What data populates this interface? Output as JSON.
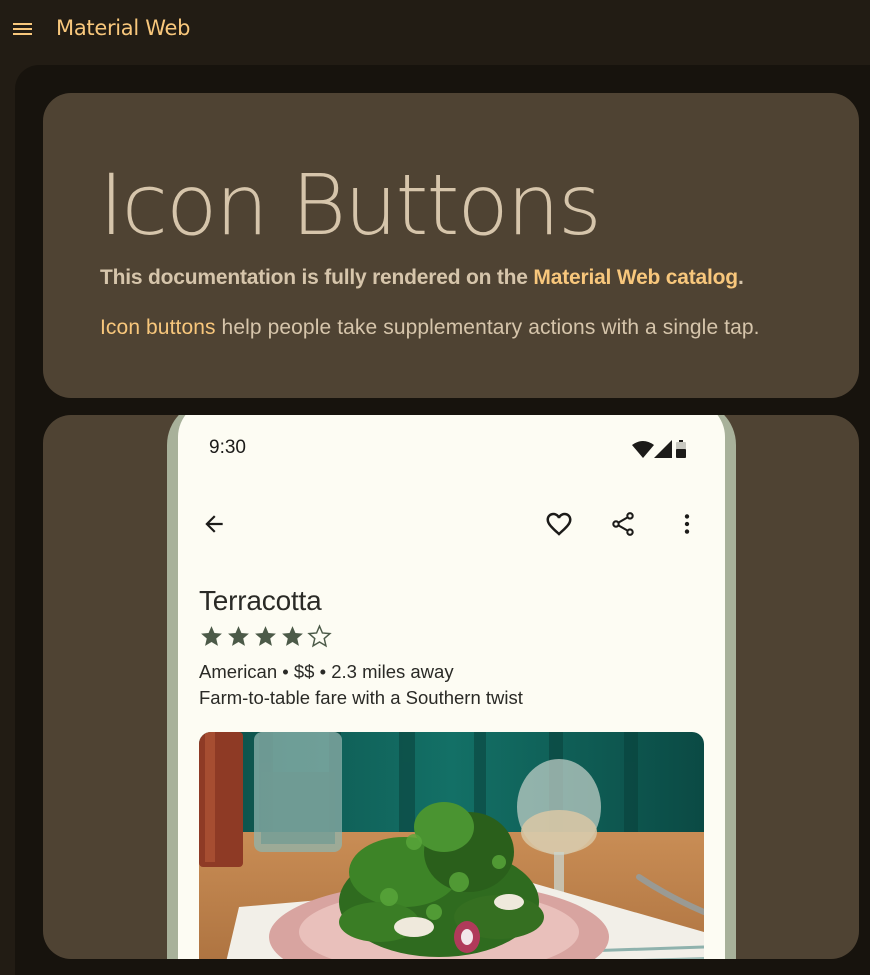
{
  "app": {
    "title": "Material Web"
  },
  "hero": {
    "title": "Icon Buttons",
    "subtitle_prefix": "This documentation is fully rendered on the ",
    "subtitle_link": "Material Web catalog",
    "subtitle_suffix": ".",
    "desc_link": "Icon buttons",
    "desc_rest": " help people take supplementary actions with a single tap."
  },
  "phone": {
    "status_time": "9:30",
    "status_icons": [
      "wifi-icon",
      "signal-icon",
      "battery-icon"
    ],
    "toolbar_icons": [
      "arrow-back-icon",
      "heart-outline-icon",
      "share-icon",
      "more-vert-icon"
    ],
    "restaurant": {
      "name": "Terracotta",
      "rating": 4,
      "rating_max": 5,
      "meta": "American • $$ • 2.3 miles away",
      "description": "Farm-to-table fare with a Southern twist"
    }
  },
  "colors": {
    "background": "#221c14",
    "panel": "#17130d",
    "card": "#4f4333",
    "accent": "#f8c77c",
    "text": "#d6c5ab",
    "phone_frame": "#a8b19a",
    "phone_screen": "#fdfcf3",
    "star": "#4c5a48"
  }
}
